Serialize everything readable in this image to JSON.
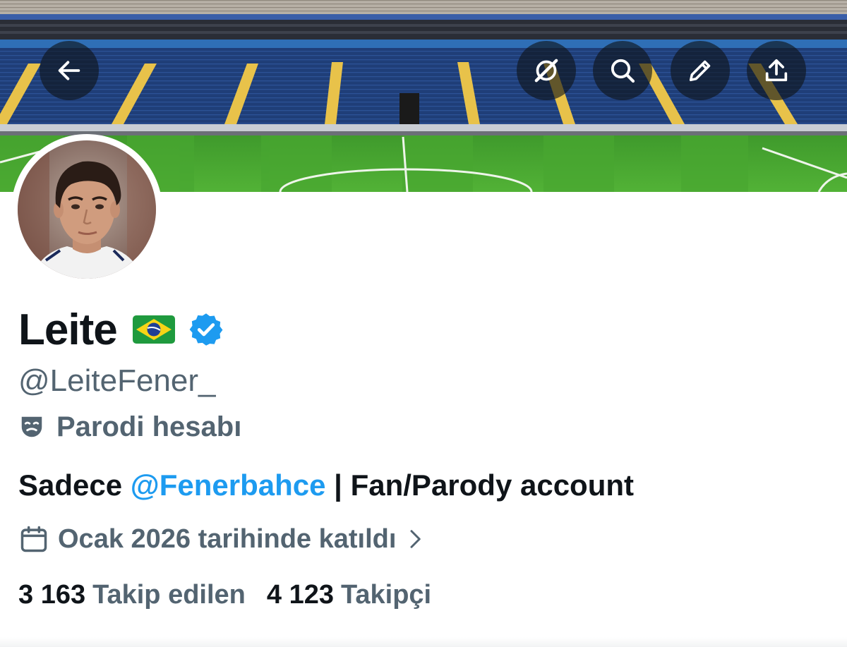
{
  "header": {
    "buttons": [
      {
        "icon": "back-arrow-icon"
      },
      {
        "icon": "grok-icon"
      },
      {
        "icon": "search-icon"
      },
      {
        "icon": "edit-pencil-icon"
      },
      {
        "icon": "share-icon"
      }
    ]
  },
  "profile": {
    "name": "Leite",
    "flag": "🇧🇷",
    "verified": true,
    "handle": "@LeiteFener_",
    "label": "Parodi hesabı",
    "bio": {
      "prefix": "Sadece ",
      "mention": "@Fenerbahce",
      "suffix": " | Fan/Parody account"
    },
    "joined": "Ocak 2026 tarihinde katıldı",
    "following_count": "3 163",
    "following_label": "Takip edilen",
    "followers_count": "4 123",
    "followers_label": "Takipçi"
  },
  "colors": {
    "accent": "#1d9bf0",
    "secondary_text": "#536471",
    "primary_text": "#0f1419"
  }
}
